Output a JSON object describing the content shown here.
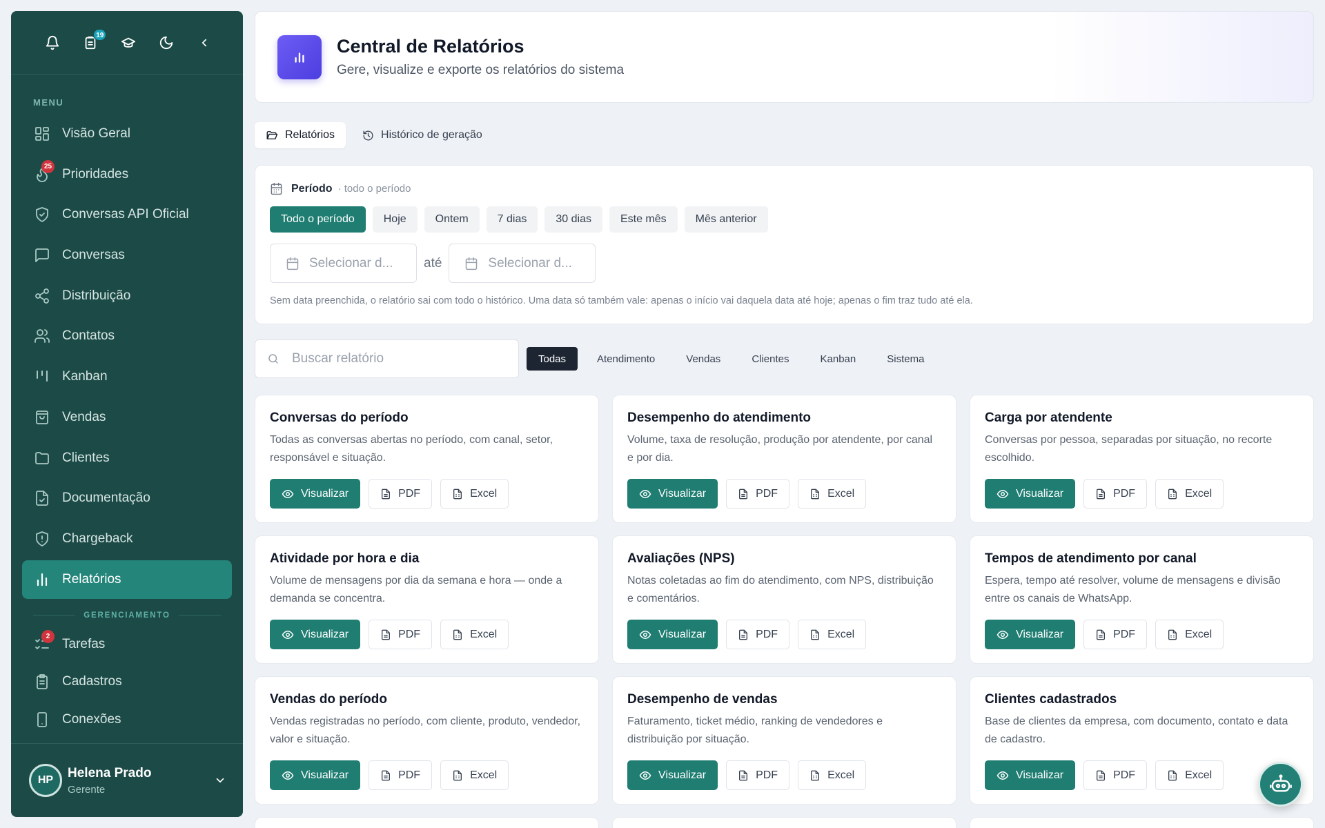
{
  "sidebar": {
    "top_icons": {
      "bell": "bell-icon",
      "notes": "clipboard-icon",
      "notes_badge": "19",
      "academy": "graduation-cap-icon",
      "theme": "moon-icon",
      "collapse": "chevron-left-icon"
    },
    "menu_label": "MENU",
    "items": [
      {
        "label": "Visão Geral",
        "icon": "grid-icon"
      },
      {
        "label": "Prioridades",
        "icon": "flame-icon",
        "badge": "25"
      },
      {
        "label": "Conversas API Oficial",
        "icon": "shield-check-icon"
      },
      {
        "label": "Conversas",
        "icon": "message-square-icon"
      },
      {
        "label": "Distribuição",
        "icon": "share-icon"
      },
      {
        "label": "Contatos",
        "icon": "users-icon"
      },
      {
        "label": "Kanban",
        "icon": "kanban-icon"
      },
      {
        "label": "Vendas",
        "icon": "shopping-bag-icon"
      },
      {
        "label": "Clientes",
        "icon": "folder-icon"
      },
      {
        "label": "Documentação",
        "icon": "file-check-icon"
      },
      {
        "label": "Chargeback",
        "icon": "shield-alert-icon"
      },
      {
        "label": "Relatórios",
        "icon": "bar-chart-icon",
        "active": true
      }
    ],
    "section_label": "GERENCIAMENTO",
    "manage_items": [
      {
        "label": "Tarefas",
        "icon": "list-checks-icon",
        "badge": "2"
      },
      {
        "label": "Cadastros",
        "icon": "clipboard-list-icon"
      },
      {
        "label": "Conexões",
        "icon": "smartphone-icon"
      }
    ],
    "user": {
      "initials": "HP",
      "name": "Helena Prado",
      "role": "Gerente"
    }
  },
  "header": {
    "title": "Central de Relatórios",
    "subtitle": "Gere, visualize e exporte os relatórios do sistema"
  },
  "tabs": [
    {
      "label": "Relatórios",
      "active": true
    },
    {
      "label": "Histórico de geração"
    }
  ],
  "period": {
    "title": "Período",
    "subtitle": "· todo o período",
    "chips": [
      "Todo o período",
      "Hoje",
      "Ontem",
      "7 dias",
      "30 dias",
      "Este mês",
      "Mês anterior"
    ],
    "active_chip": "Todo o período",
    "date_from_placeholder": "Selecionar d...",
    "date_sep": "até",
    "date_to_placeholder": "Selecionar d...",
    "hint": "Sem data preenchida, o relatório sai com todo o histórico. Uma data só também vale: apenas o início vai daquela data até hoje; apenas o fim traz tudo até ela."
  },
  "filters": {
    "search_placeholder": "Buscar relatório",
    "categories": [
      "Todas",
      "Atendimento",
      "Vendas",
      "Clientes",
      "Kanban",
      "Sistema"
    ],
    "active": "Todas"
  },
  "actions": {
    "view": "Visualizar",
    "pdf": "PDF",
    "excel": "Excel"
  },
  "reports": [
    {
      "title": "Conversas do período",
      "desc": "Todas as conversas abertas no período, com canal, setor, responsável e situação."
    },
    {
      "title": "Desempenho do atendimento",
      "desc": "Volume, taxa de resolução, produção por atendente, por canal e por dia."
    },
    {
      "title": "Carga por atendente",
      "desc": "Conversas por pessoa, separadas por situação, no recorte escolhido."
    },
    {
      "title": "Atividade por hora e dia",
      "desc": "Volume de mensagens por dia da semana e hora — onde a demanda se concentra."
    },
    {
      "title": "Avaliações (NPS)",
      "desc": "Notas coletadas ao fim do atendimento, com NPS, distribuição e comentários."
    },
    {
      "title": "Tempos de atendimento por canal",
      "desc": "Espera, tempo até resolver, volume de mensagens e divisão entre os canais de WhatsApp."
    },
    {
      "title": "Vendas do período",
      "desc": "Vendas registradas no período, com cliente, produto, vendedor, valor e situação."
    },
    {
      "title": "Desempenho de vendas",
      "desc": "Faturamento, ticket médio, ranking de vendedores e distribuição por situação."
    },
    {
      "title": "Clientes cadastrados",
      "desc": "Base de clientes da empresa, com documento, contato e data de cadastro."
    }
  ],
  "colors": {
    "sidebar": "#1c4b47",
    "accent": "#1f7d72",
    "header_icon": "#5b4cf0"
  }
}
